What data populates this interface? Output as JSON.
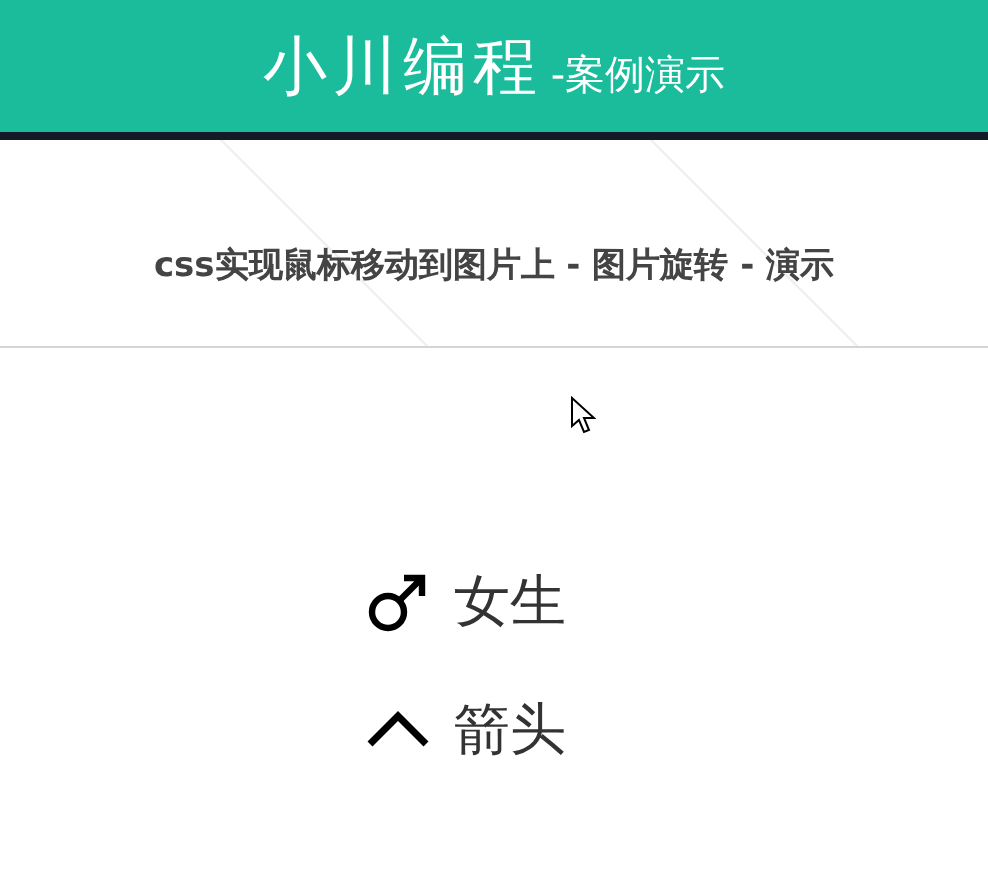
{
  "header": {
    "brand": "小川编程",
    "subtitle": "-案例演示"
  },
  "banner": {
    "title": "css实现鼠标移动到图片上 - 图片旋转 - 演示"
  },
  "items": [
    {
      "kind": "male",
      "label": "女生"
    },
    {
      "kind": "chevron",
      "label": "箭头"
    }
  ]
}
